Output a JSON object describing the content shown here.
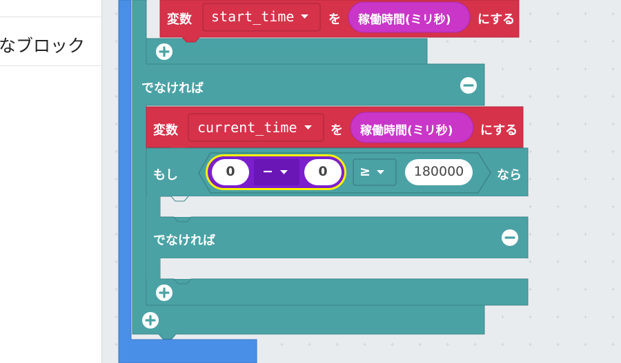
{
  "sidebar": {
    "category_label": "なブロック"
  },
  "blocks": {
    "set_start": {
      "var_keyword": "変数",
      "var_name": "start_time",
      "to_keyword": "を",
      "value_label": "稼働時間(ミリ秒)",
      "suffix": "にする"
    },
    "outer_else_label": "でなければ",
    "set_current": {
      "var_keyword": "変数",
      "var_name": "current_time",
      "to_keyword": "を",
      "value_label": "稼働時間(ミリ秒)",
      "suffix": "にする"
    },
    "inner_if": {
      "if_keyword": "もし",
      "left_operand": "0",
      "operator": "−",
      "right_operand": "0",
      "compare_operator": "≥",
      "compare_value": "180000",
      "then_keyword": "なら",
      "else_label": "でなければ"
    }
  },
  "colors": {
    "logic": "#4ba2a5",
    "variables": "#d6324a",
    "input": "#c936c8",
    "math": "#7b1fcc",
    "loop": "#4a8fe7",
    "highlight": "#fff200"
  },
  "icons": [
    "dropdown-caret-icon",
    "plus-icon",
    "minus-icon"
  ]
}
